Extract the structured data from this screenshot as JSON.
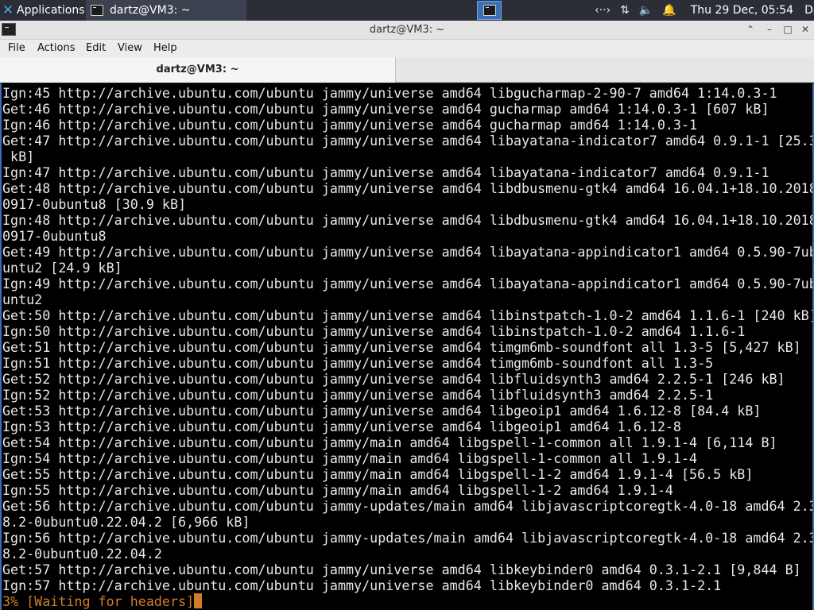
{
  "panel": {
    "applications_label": "Applications",
    "task_label": "dartz@VM3: ~",
    "clock": "Thu 29 Dec, 05:54",
    "user": "Dartz"
  },
  "window": {
    "title": "dartz@VM3: ~",
    "menu": [
      "File",
      "Actions",
      "Edit",
      "View",
      "Help"
    ],
    "tab_label": "dartz@VM3: ~"
  },
  "terminal": {
    "lines": [
      "Ign:45 http://archive.ubuntu.com/ubuntu jammy/universe amd64 libgucharmap-2-90-7 amd64 1:14.0.3-1",
      "Get:46 http://archive.ubuntu.com/ubuntu jammy/universe amd64 gucharmap amd64 1:14.0.3-1 [607 kB]",
      "Ign:46 http://archive.ubuntu.com/ubuntu jammy/universe amd64 gucharmap amd64 1:14.0.3-1",
      "Get:47 http://archive.ubuntu.com/ubuntu jammy/universe amd64 libayatana-indicator7 amd64 0.9.1-1 [25.3",
      " kB]",
      "Ign:47 http://archive.ubuntu.com/ubuntu jammy/universe amd64 libayatana-indicator7 amd64 0.9.1-1",
      "Get:48 http://archive.ubuntu.com/ubuntu jammy/universe amd64 libdbusmenu-gtk4 amd64 16.04.1+18.10.2018",
      "0917-0ubuntu8 [30.9 kB]",
      "Ign:48 http://archive.ubuntu.com/ubuntu jammy/universe amd64 libdbusmenu-gtk4 amd64 16.04.1+18.10.2018",
      "0917-0ubuntu8",
      "Get:49 http://archive.ubuntu.com/ubuntu jammy/universe amd64 libayatana-appindicator1 amd64 0.5.90-7ub",
      "untu2 [24.9 kB]",
      "Ign:49 http://archive.ubuntu.com/ubuntu jammy/universe amd64 libayatana-appindicator1 amd64 0.5.90-7ub",
      "untu2",
      "Get:50 http://archive.ubuntu.com/ubuntu jammy/universe amd64 libinstpatch-1.0-2 amd64 1.1.6-1 [240 kB]",
      "Ign:50 http://archive.ubuntu.com/ubuntu jammy/universe amd64 libinstpatch-1.0-2 amd64 1.1.6-1",
      "Get:51 http://archive.ubuntu.com/ubuntu jammy/universe amd64 timgm6mb-soundfont all 1.3-5 [5,427 kB]",
      "Ign:51 http://archive.ubuntu.com/ubuntu jammy/universe amd64 timgm6mb-soundfont all 1.3-5",
      "Get:52 http://archive.ubuntu.com/ubuntu jammy/universe amd64 libfluidsynth3 amd64 2.2.5-1 [246 kB]",
      "Ign:52 http://archive.ubuntu.com/ubuntu jammy/universe amd64 libfluidsynth3 amd64 2.2.5-1",
      "Get:53 http://archive.ubuntu.com/ubuntu jammy/universe amd64 libgeoip1 amd64 1.6.12-8 [84.4 kB]",
      "Ign:53 http://archive.ubuntu.com/ubuntu jammy/universe amd64 libgeoip1 amd64 1.6.12-8",
      "Get:54 http://archive.ubuntu.com/ubuntu jammy/main amd64 libgspell-1-common all 1.9.1-4 [6,114 B]",
      "Ign:54 http://archive.ubuntu.com/ubuntu jammy/main amd64 libgspell-1-common all 1.9.1-4",
      "Get:55 http://archive.ubuntu.com/ubuntu jammy/main amd64 libgspell-1-2 amd64 1.9.1-4 [56.5 kB]",
      "Ign:55 http://archive.ubuntu.com/ubuntu jammy/main amd64 libgspell-1-2 amd64 1.9.1-4",
      "Get:56 http://archive.ubuntu.com/ubuntu jammy-updates/main amd64 libjavascriptcoregtk-4.0-18 amd64 2.3",
      "8.2-0ubuntu0.22.04.2 [6,966 kB]",
      "Ign:56 http://archive.ubuntu.com/ubuntu jammy-updates/main amd64 libjavascriptcoregtk-4.0-18 amd64 2.3",
      "8.2-0ubuntu0.22.04.2",
      "Get:57 http://archive.ubuntu.com/ubuntu jammy/universe amd64 libkeybinder0 amd64 0.3.1-2.1 [9,844 B]",
      "Ign:57 http://archive.ubuntu.com/ubuntu jammy/universe amd64 libkeybinder0 amd64 0.3.1-2.1"
    ],
    "progress_line": "3% [Waiting for headers]",
    "progress_color": "#cf7d2b"
  }
}
